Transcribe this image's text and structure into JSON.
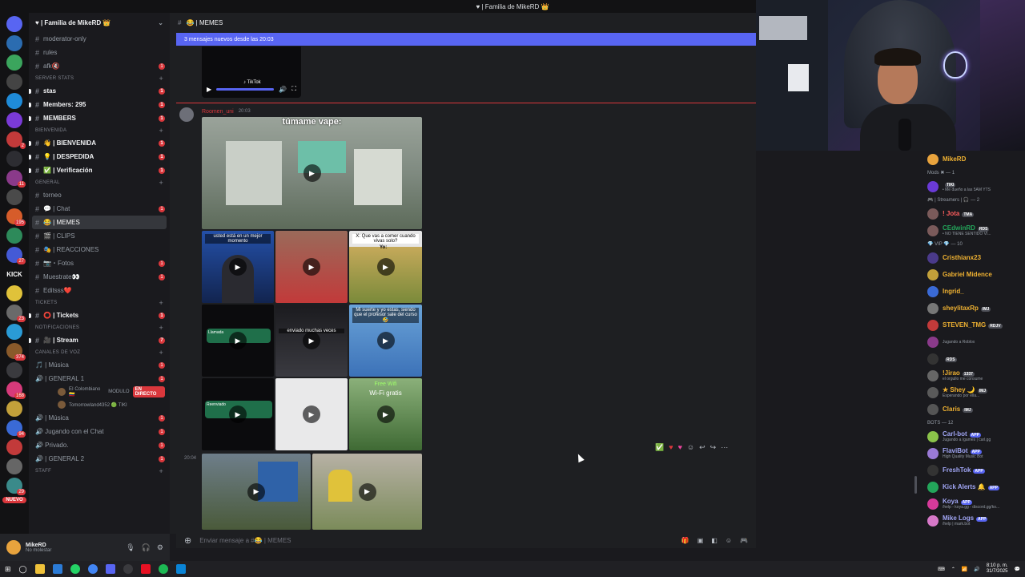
{
  "window": {
    "title": "♥ | Familia de MikeRD 👑"
  },
  "servers": {
    "badges": [
      "",
      "",
      "",
      "",
      "",
      "",
      "2",
      "",
      "11",
      "",
      "195",
      "",
      "27",
      "",
      "",
      "23",
      "",
      "374",
      "",
      "168",
      "",
      "94",
      "",
      "",
      "29"
    ],
    "kick_label": "KICK",
    "nuevo_label": "NUEVO"
  },
  "guild": {
    "name": "♥ | Familia de MikeRD 👑",
    "chevron": "⌄"
  },
  "channels": {
    "top": [
      {
        "name": "moderator-only",
        "badge": ""
      },
      {
        "name": "rules",
        "badge": ""
      },
      {
        "name": "afk🔇",
        "badge": "1"
      }
    ],
    "cat_server_stats": "SERVER STATS",
    "server_stats": [
      {
        "name": "stas",
        "badge": "1"
      },
      {
        "name": "Members: 295",
        "badge": "1"
      },
      {
        "name": "MEMBERS",
        "badge": "1"
      }
    ],
    "cat_bienvenida": "BIENVENIDA",
    "bienvenida": [
      {
        "name": "👋 | BIENVENIDA",
        "badge": "1"
      },
      {
        "name": "💡 | DESPEDIDA",
        "badge": "1"
      },
      {
        "name": "✅ | Verificación",
        "badge": "1"
      }
    ],
    "cat_general": "GENERAL",
    "general": [
      {
        "name": "torneo",
        "badge": ""
      },
      {
        "name": "💬 | Chat",
        "badge": "1"
      },
      {
        "name": "😂 | MEMES",
        "badge": ""
      },
      {
        "name": "🎬 | CLIPS",
        "badge": ""
      },
      {
        "name": "🎭 | REACCIONES",
        "badge": ""
      },
      {
        "name": "📷・Fotos",
        "badge": "1"
      },
      {
        "name": "Muestrate👀",
        "badge": "1"
      },
      {
        "name": "Editsss❤️",
        "badge": ""
      }
    ],
    "cat_tickets": "TICKETS",
    "tickets": [
      {
        "name": "⭕ | Tickets",
        "badge": "1"
      }
    ],
    "cat_notificaciones": "NOTIFICACIONES",
    "notificaciones": [
      {
        "name": "🎥 | Stream",
        "badge": "7"
      }
    ],
    "cat_voz": "Canales de voz",
    "voz": [
      {
        "name": "🎵 | Música",
        "badge": "1"
      },
      {
        "name": "🔊 | GENERAL 1",
        "badge": "1"
      }
    ],
    "vc_users": [
      {
        "name": "EI Colombiano 🇨🇴",
        "extra": "MODULO",
        "live": "EN DIRECTO"
      },
      {
        "name": "Tomorrowland4352 🟢 TIKI",
        "extra": "",
        "live": ""
      }
    ],
    "voz2": [
      {
        "name": "🔊 | Música",
        "badge": "1"
      },
      {
        "name": "🔊 Jugando con el Chat",
        "badge": "1"
      },
      {
        "name": "🔊 Privado.",
        "badge": "1"
      },
      {
        "name": "🔊 | GENERAL 2",
        "badge": "1"
      }
    ],
    "cat_staff": "STAFF"
  },
  "user_panel": {
    "name": "MikeRD",
    "status": "No molestar"
  },
  "channel_header": {
    "title": "😂 | MEMES"
  },
  "new_messages_banner": "3 mensajes nuevos desde las 20:03",
  "video_stub": {
    "tiktok": "♪ TikTok"
  },
  "message": {
    "author": "Roomen_uni",
    "time": "20:03",
    "second_time": "20:04",
    "captions": {
      "top_video": "túmame vape:",
      "grid_1": "usted está en un mejor momento",
      "grid_3": "X: Que vas a comer cuando vivas solo?",
      "grid_3b": "Yo:",
      "grid_4": "Llamada",
      "grid_5": "enviado muchas veces",
      "grid_6": "Mi suerte y yo estas, siendo que el profesor sale del curso 🤣",
      "grid_7": "Reenviado",
      "grid_9": "Free Wifi",
      "grid_9b": "Wi-Fi gratis"
    }
  },
  "composer": {
    "placeholder": "Enviar mensaje a #😂 | MEMES"
  },
  "members": {
    "owner": {
      "name": "MikeRD"
    },
    "mods_header": "Mods ✖ — 1",
    "mods": [
      {
        "name": "",
        "sub": "• Me dueño a las 5AM YTS",
        "tag": "TIKI"
      }
    ],
    "streamers_header": "🎮 | Streamers | 🎧 — 2",
    "streamers": [
      {
        "name": "! Jota",
        "tag": "TMA",
        "sub": ""
      },
      {
        "name": "CEdwinRD",
        "tag": "RDS",
        "sub": "• NO TIENE SENTIDO VI..."
      }
    ],
    "vip_header": "💎 VIP 💎 — 10",
    "vips": [
      {
        "name": "Cristhianx23",
        "tag": "",
        "sub": "",
        "color": "#f0b232"
      },
      {
        "name": "Gabriel Midence",
        "tag": "",
        "sub": "",
        "color": "#f0b232"
      },
      {
        "name": "Ingrid_",
        "tag": "",
        "sub": "",
        "color": "#f0b232"
      },
      {
        "name": "sheylitaxRp",
        "tag": "IMJ",
        "sub": "",
        "color": "#f0b232"
      },
      {
        "name": "STEVEN_TMG",
        "tag": "RDJV",
        "sub": "",
        "color": "#f0b232"
      },
      {
        "name": "",
        "tag": "",
        "sub": "Jugando a Roblox",
        "color": "#f0b232"
      },
      {
        "name": "",
        "tag": "RDS",
        "sub": "",
        "color": "#f0b232"
      },
      {
        "name": "!Jirao",
        "tag": "1337",
        "sub": "el orgullo me consume",
        "color": "#f0b232"
      },
      {
        "name": "★ Shey 🌙",
        "tag": "IMJ",
        "sub": "Esperando por ella...",
        "color": "#f0b232"
      },
      {
        "name": "Claris",
        "tag": "IMJ",
        "sub": "",
        "color": "#f0b232"
      }
    ],
    "bots_header": "BOTS — 12",
    "bots": [
      {
        "name": "Carl-bot",
        "app": "APP",
        "sub": "Jugando a /games | carl.gg"
      },
      {
        "name": "FlaviBot",
        "app": "APP",
        "sub": "High Quality Music Bot"
      },
      {
        "name": "FreshTok",
        "app": "APP",
        "sub": ""
      },
      {
        "name": "Kick Alerts 🔔",
        "app": "APP",
        "sub": ""
      },
      {
        "name": "Koya",
        "app": "APP",
        "sub": "/help - koya.gg - discord.gg/ko..."
      },
      {
        "name": "Mike Logs",
        "app": "APP",
        "sub": "/help | mark.bot"
      }
    ]
  },
  "taskbar": {
    "time": "8:10 p. m.",
    "date": "31/7/2025"
  },
  "colors": {
    "accent": "#5865f2",
    "danger": "#da373c",
    "vip": "#f0b232",
    "bot": "#a1a6f5",
    "streamer": "#ff5e5e",
    "online": "#23a55a"
  }
}
